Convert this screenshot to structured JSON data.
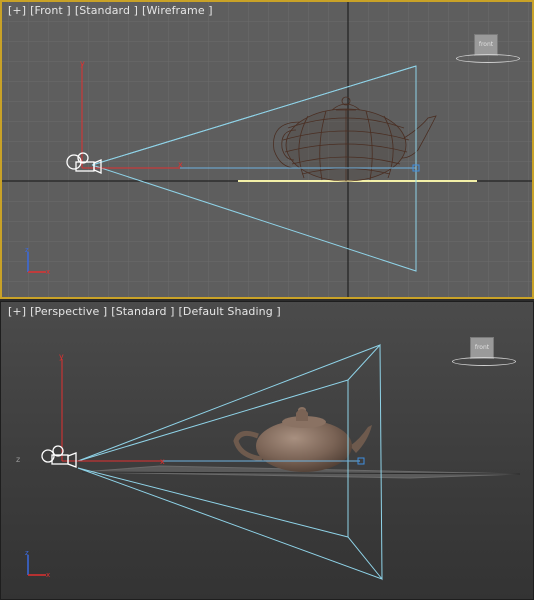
{
  "front_viewport": {
    "label_menu": "[+]",
    "label_view": "[Front ]",
    "label_mode": "[Standard ]",
    "label_shading": "[Wireframe ]",
    "viewcube_face": "front",
    "local_axis_x": "x",
    "local_axis_y": "y",
    "tripod_x": "x",
    "tripod_z": "z"
  },
  "perspective_viewport": {
    "label_menu": "[+]",
    "label_view": "[Perspective ]",
    "label_mode": "[Standard ]",
    "label_shading": "[Default Shading ]",
    "viewcube_face": "front",
    "local_axis_x": "x",
    "local_axis_y": "y",
    "local_axis_z": "z",
    "tripod_x": "x",
    "tripod_z": "z"
  },
  "colors": {
    "active_border": "#c9a227",
    "camera_cone": "#8fd3e8",
    "target_line": "#6fb3e0",
    "axis_x": "#e03030",
    "axis_y": "#e03030",
    "teapot_wire": "#4a2e22",
    "teapot_shaded": "#7a6355",
    "grid_plane_highlight": "#f3f0a8"
  }
}
